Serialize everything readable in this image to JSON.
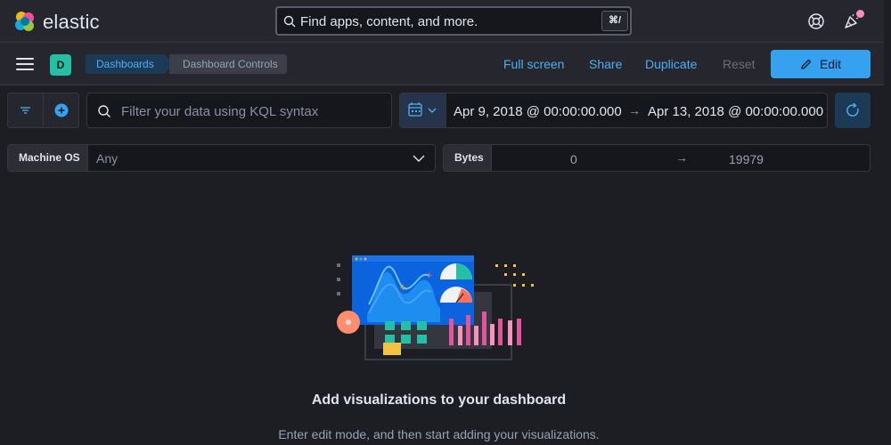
{
  "brand": {
    "name": "elastic"
  },
  "global_search": {
    "placeholder": "Find apps, content, and more.",
    "shortcut": "⌘/"
  },
  "header_icons": {
    "help": "help-icon",
    "news": "newsfeed-icon"
  },
  "space": {
    "initial": "D"
  },
  "breadcrumbs": [
    {
      "label": "Dashboards"
    },
    {
      "label": "Dashboard Controls"
    }
  ],
  "actions": {
    "full_screen": "Full screen",
    "share": "Share",
    "duplicate": "Duplicate",
    "reset": "Reset",
    "edit": "Edit"
  },
  "query": {
    "placeholder": "Filter your data using KQL syntax"
  },
  "time": {
    "start": "Apr 9, 2018 @ 00:00:00.000",
    "arrow": "→",
    "end": "Apr 13, 2018 @ 00:00:00.000"
  },
  "controls": {
    "machine_os": {
      "label": "Machine OS",
      "value": "Any"
    },
    "bytes": {
      "label": "Bytes",
      "min": "0",
      "arrow": "→",
      "max": "19979"
    }
  },
  "empty_state": {
    "title": "Add visualizations to your dashboard",
    "body": "Enter edit mode, and then start adding your visualizations."
  },
  "colors": {
    "accent": "#36a2ef",
    "link": "#4cb0f5",
    "background": "#1d1e24",
    "header": "#25262e",
    "space": "#25bfa6"
  }
}
